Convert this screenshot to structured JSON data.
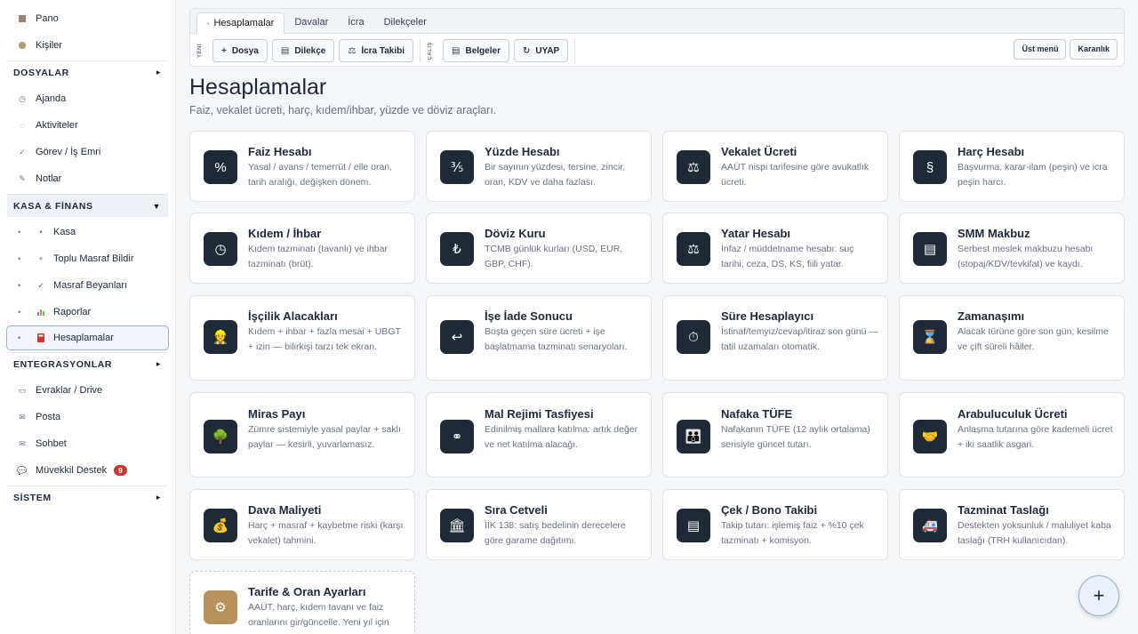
{
  "sidebar": {
    "top_items": [
      {
        "label": "Pano",
        "icon": "dashboard-icon"
      },
      {
        "label": "Kişiler",
        "icon": "contacts-icon"
      }
    ],
    "dosyalar": {
      "label": "DOSYALAR",
      "arrow": "▸"
    },
    "dosyalar_items": [
      {
        "label": "Ajanda",
        "icon": "clock-icon"
      },
      {
        "label": "Aktiviteler",
        "icon": "activity-icon"
      },
      {
        "label": "Görev / İş Emri",
        "icon": "check-icon"
      },
      {
        "label": "Notlar",
        "icon": "pencil-icon"
      }
    ],
    "kasa": {
      "label": "KASA & FİNANS",
      "arrow": "▼"
    },
    "kasa_items": [
      {
        "label": "Kasa",
        "icon": "dot-icon"
      },
      {
        "label": "Toplu Masraf Bildir",
        "icon": "plus-icon"
      },
      {
        "label": "Masraf Beyanları",
        "icon": "check-icon"
      },
      {
        "label": "Raporlar",
        "icon": "bar-chart-icon"
      },
      {
        "label": "Hesaplamalar",
        "icon": "calculator-icon"
      }
    ],
    "entegrasyonlar": {
      "label": "ENTEGRASYONLAR",
      "arrow": "▸"
    },
    "entegrasyon_items": [
      {
        "label": "Evraklar / Drive",
        "icon": "folder-icon"
      },
      {
        "label": "Posta",
        "icon": "mail-icon"
      },
      {
        "label": "Sohbet",
        "icon": "chat-icon"
      },
      {
        "label": "Müvekkil Destek",
        "icon": "support-icon",
        "badge": "9"
      }
    ],
    "sistem": {
      "label": "SİSTEM",
      "arrow": "▸"
    }
  },
  "tabs": [
    "Hesaplamalar",
    "Davalar",
    "İcra",
    "Dilekçeler"
  ],
  "toolbar": {
    "group1_label": "YENİ",
    "group2_label": "ÇALIŞ",
    "buttons1": [
      {
        "label": "Dosya",
        "icon": "+"
      },
      {
        "label": "Dilekçe",
        "icon": "▤"
      },
      {
        "label": "İcra Takibi",
        "icon": "⚖"
      }
    ],
    "buttons2": [
      {
        "label": "Belgeler",
        "icon": "▤"
      },
      {
        "label": "UYAP",
        "icon": "↻"
      }
    ],
    "right": [
      "Üst menü",
      "Karanlık"
    ]
  },
  "page": {
    "title": "Hesaplamalar",
    "subtitle": "Faiz, vekalet ücreti, harç, kıdem/ihbar, yüzde ve döviz araçları."
  },
  "cards": [
    {
      "title": "Faiz Hesabı",
      "desc": "Yasal / avans / temerrüt / elle oran, tarih aralığı, değişken dönem.",
      "icon": "%",
      "icon_name": "percent-icon"
    },
    {
      "title": "Yüzde Hesabı",
      "desc": "Bir sayının yüzdesi, tersine, zincir, oran, KDV ve daha fazlası.",
      "icon": "⅗",
      "icon_name": "fraction-icon"
    },
    {
      "title": "Vekalet Ücreti",
      "desc": "AAÜT nispi tarifesine göre avukatlık ücreti.",
      "icon": "⚖",
      "icon_name": "scales-icon"
    },
    {
      "title": "Harç Hesabı",
      "desc": "Başvurma, karar-ilam (peşin) ve icra peşin harcı.",
      "icon": "§",
      "icon_name": "section-icon"
    },
    {
      "title": "Kıdem / İhbar",
      "desc": "Kıdem tazminatı (tavanlı) ve ihbar tazminatı (brüt).",
      "icon": "◷",
      "icon_name": "clock-icon"
    },
    {
      "title": "Döviz Kuru",
      "desc": "TCMB günlük kurları (USD, EUR, GBP, CHF).",
      "icon": "₺",
      "icon_name": "lira-icon"
    },
    {
      "title": "Yatar Hesabı",
      "desc": "İnfaz / müddetname hesabı: suç tarihi, ceza, DS, KS, fiili yatar.",
      "icon": "⚖",
      "icon_name": "scales-icon"
    },
    {
      "title": "SMM Makbuz",
      "desc": "Serbest meslek makbuzu hesabı (stopaj/KDV/tevkifat) ve kaydı.",
      "icon": "▤",
      "icon_name": "receipt-icon"
    },
    {
      "title": "İşçilik Alacakları",
      "desc": "Kıdem + ihbar + fazla mesai + UBGT + izin — bilirkişi tarzı tek ekran.",
      "icon": "👷",
      "icon_name": "worker-icon"
    },
    {
      "title": "İşe İade Sonucu",
      "desc": "Boşta geçen süre ücreti + işe başlatmama tazminatı senaryoları.",
      "icon": "↩",
      "icon_name": "return-icon"
    },
    {
      "title": "Süre Hesaplayıcı",
      "desc": "İstinaf/temyiz/cevap/itiraz son günü — tatil uzamaları otomatik.",
      "icon": "⏱",
      "icon_name": "stopwatch-icon"
    },
    {
      "title": "Zamanaşımı",
      "desc": "Alacak türüne göre son gün; kesilme ve çift süreli hâller.",
      "icon": "⌛",
      "icon_name": "hourglass-icon"
    },
    {
      "title": "Miras Payı",
      "desc": "Zümre sistemiyle yasal paylar + saklı paylar — kesirli, yuvarlamasız.",
      "icon": "🌳",
      "icon_name": "tree-icon"
    },
    {
      "title": "Mal Rejimi Tasfiyesi",
      "desc": "Edinilmiş mallara katılma: artık değer ve net katılma alacağı.",
      "icon": "⚭",
      "icon_name": "rings-icon"
    },
    {
      "title": "Nafaka TÜFE",
      "desc": "Nafakanın TÜFE (12 aylık ortalama) serisiyle güncel tutarı.",
      "icon": "👪",
      "icon_name": "family-icon"
    },
    {
      "title": "Arabuluculuk Ücreti",
      "desc": "Anlaşma tutarına göre kademeli ücret + iki saatlik asgari.",
      "icon": "🤝",
      "icon_name": "handshake-icon"
    },
    {
      "title": "Dava Maliyeti",
      "desc": "Harç + masraf + kaybetme riski (karşı vekalet) tahmini.",
      "icon": "💰",
      "icon_name": "money-bag-icon"
    },
    {
      "title": "Sıra Cetveli",
      "desc": "İİK 138: satış bedelinin derecelere göre garame dağıtımı.",
      "icon": "🏛",
      "icon_name": "bank-icon"
    },
    {
      "title": "Çek / Bono Takibi",
      "desc": "Takip tutarı: işlemiş faiz + %10 çek tazminatı + komisyon.",
      "icon": "▤",
      "icon_name": "document-icon"
    },
    {
      "title": "Tazminat Taslağı",
      "desc": "Destekten yoksunluk / maluliyet kaba taslağı (TRH kullanıcıdan).",
      "icon": "🚑",
      "icon_name": "ambulance-icon"
    },
    {
      "title": "Tarife & Oran Ayarları",
      "desc": "AAÜT, harç, kıdem tavanı ve faiz oranlarını gir/güncelle. Yeni yıl için",
      "icon": "⚙",
      "icon_name": "gear-icon",
      "special": true
    }
  ],
  "fab": "+"
}
